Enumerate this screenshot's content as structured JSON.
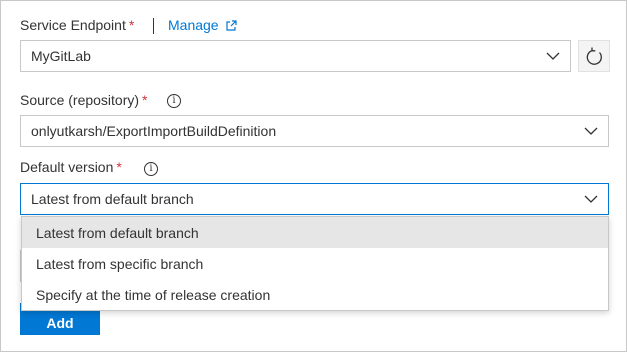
{
  "service_endpoint": {
    "label": "Service Endpoint",
    "required_mark": "*",
    "manage_link": "Manage",
    "selected_value": "MyGitLab"
  },
  "source": {
    "label": "Source (repository)",
    "required_mark": "*",
    "info_glyph": "i",
    "selected_value": "onlyutkarsh/ExportImportBuildDefinition"
  },
  "default_version": {
    "label": "Default version",
    "required_mark": "*",
    "info_glyph": "i",
    "selected_value": "Latest from default branch",
    "options": [
      "Latest from default branch",
      "Latest from specific branch",
      "Specify at the time of release creation"
    ],
    "selected_index": 0
  },
  "add_button": {
    "label": "Add"
  },
  "colors": {
    "accent": "#0078d4",
    "required": "#d13438",
    "selected_option_bg": "#e6e6e6"
  }
}
